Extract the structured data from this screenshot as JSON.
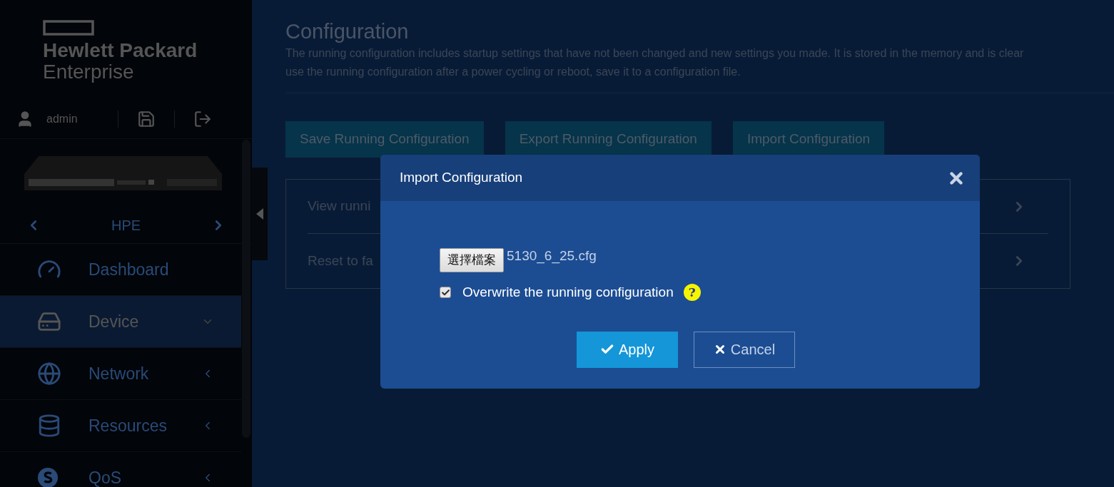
{
  "sidebar": {
    "logo": {
      "line_1": "Hewlett Packard",
      "line_2": "Enterprise"
    },
    "user": "admin",
    "device_name": "HPE",
    "menu": [
      {
        "label": "Dashboard",
        "kind": "gauge",
        "selected": false
      },
      {
        "label": "Device",
        "kind": "drive",
        "selected": true,
        "expanded": true
      },
      {
        "label": "Network",
        "kind": "globe",
        "selected": false,
        "expanded": false
      },
      {
        "label": "Resources",
        "kind": "database",
        "selected": false,
        "expanded": false
      },
      {
        "label": "QoS",
        "kind": "qos",
        "selected": false,
        "expanded": false
      }
    ]
  },
  "page": {
    "title": "Configuration",
    "description": [
      "The running configuration includes startup settings that have not been changed and new settings you made. It is stored in the memory and is clear",
      "use the running configuration after a power cycling or reboot, save it to a configuration file."
    ],
    "buttons": [
      "Save Running Configuration",
      "Export Running Configuration",
      "Import Configuration"
    ],
    "actions": [
      "View runni",
      "Reset to fa"
    ]
  },
  "dialog": {
    "title": "Import Configuration",
    "file_button": "選擇檔案",
    "file_name": "5130_6_25.cfg",
    "overwrite": {
      "label": "Overwrite the running configuration",
      "checked": true,
      "help": "?"
    },
    "apply": "Apply",
    "cancel": "Cancel"
  }
}
